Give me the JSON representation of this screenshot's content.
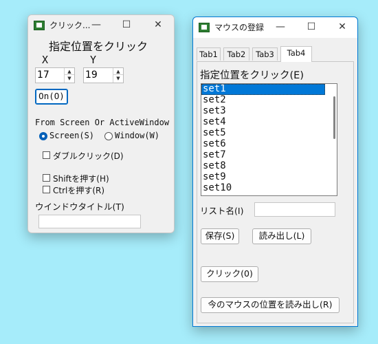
{
  "window1": {
    "title": "クリック...",
    "heading": "指定位置をクリック",
    "x_label": "X",
    "y_label": "Y",
    "x_value": "17",
    "y_value": "19",
    "on_button": "On(O)",
    "from_label": "From Screen Or ActiveWindow",
    "radio_screen": "Screen(S)",
    "radio_window": "Window(W)",
    "double_click": "ダブルクリック(D)",
    "shift": "Shiftを押す(H)",
    "ctrl": "Ctrlを押す(R)",
    "window_title_label": "ウインドウタイトル(T)",
    "window_title_value": ""
  },
  "window2": {
    "title": "マウスの登録",
    "tabs": [
      "Tab1",
      "Tab2",
      "Tab3",
      "Tab4"
    ],
    "heading": "指定位置をクリック(E)",
    "list_items": [
      "set1",
      "set2",
      "set3",
      "set4",
      "set5",
      "set6",
      "set7",
      "set8",
      "set9",
      "set10"
    ],
    "list_name_label": "リスト名(I)",
    "list_name_value": "",
    "save_button": "保存(S)",
    "load_button": "読み出し(L)",
    "click_button": "クリック(0)",
    "read_position_button": "今のマウスの位置を読み出し(R)"
  },
  "icons": {
    "minimize": "—",
    "maximize": "☐",
    "close": "✕",
    "up": "▲",
    "down": "▼"
  }
}
